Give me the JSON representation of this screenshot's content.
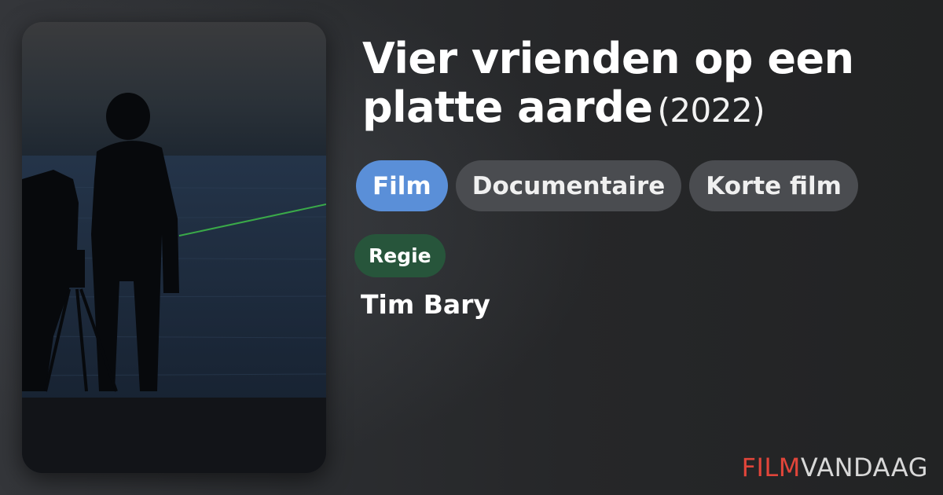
{
  "movie": {
    "title": "Vier vrienden op een platte aarde",
    "year": "(2022)"
  },
  "genres": [
    {
      "label": "Film",
      "primary": true
    },
    {
      "label": "Documentaire",
      "primary": false
    },
    {
      "label": "Korte film",
      "primary": false
    }
  ],
  "credits": {
    "role": "Regie",
    "name": "Tim Bary"
  },
  "brand": {
    "part1": "FILM",
    "part2": "VANDAAG"
  },
  "colors": {
    "primary_chip": "#5a8fd8",
    "role_badge": "#27553b",
    "brand_accent": "#e0453a",
    "laser": "#3fbf4a"
  }
}
